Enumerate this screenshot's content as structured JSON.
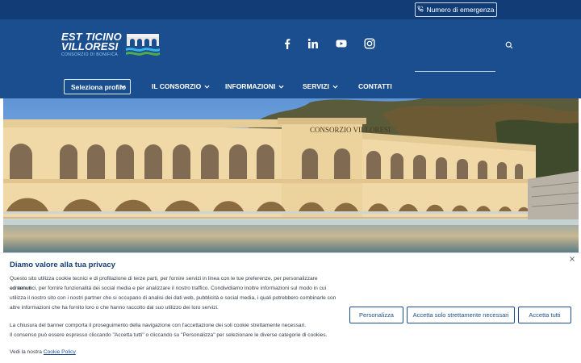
{
  "topbar": {
    "emergency_label": "Numero di emergenza"
  },
  "logo": {
    "line1": "EST TICINO",
    "line2": "VILLORESI",
    "subtitle": "CONSORZIO DI BONIFICA"
  },
  "social": [
    "facebook-icon",
    "linkedin-icon",
    "youtube-icon",
    "instagram-icon"
  ],
  "search": {
    "placeholder": ""
  },
  "nav": {
    "profile_label": "Seleziona profilo",
    "items": [
      {
        "label": "IL CONSORZIO",
        "has_dropdown": true
      },
      {
        "label": "INFORMAZIONI",
        "has_dropdown": true
      },
      {
        "label": "SERVIZI",
        "has_dropdown": true
      },
      {
        "label": "CONTATTI",
        "has_dropdown": false
      }
    ]
  },
  "hero": {
    "building_sign": "CONSORZIO VILLORESI"
  },
  "cookie": {
    "title": "Diamo valore alla tua privacy",
    "p1_l1": "Questo sito utilizza cookie tecnici e di profilazione di terze parti, per fornire servizi in linea con le tue preferenze, per personalizzare contenuti",
    "p1_l2": "ed annunci, per fornire funzionalità dei social media e per analizzare il nostro traffico. Condividiamo inoltre informazioni sul modo in cui",
    "p1_l3": "utilizza il nostro sito con i nostri partner che si occupano di analisi dei dati web, pubblicità e social media, i quali potrebbero combinarle con",
    "p1_l4": "altre informazioni che ha fornito loro o che hanno raccolto dal suo utilizzo dei loro servizi.",
    "p2_l1": "La chiusura del banner comporta il proseguimento della navigazione con l'accettazione dei soli cookie strettamente necessari.",
    "p2_l2": "Il consenso può essere espresso cliccando \"Accetta tutti\" o cliccando su \"Personalizza\" per selezionare le diverse categorie di cookies.",
    "policy_prefix": "Vedi la nostra",
    "policy_link": "Cookie Policy",
    "btn_customize": "Personalizza",
    "btn_necessary": "Accetta solo strettamente necessari",
    "btn_accept_all": "Accetta tutti"
  },
  "colors": {
    "topbar": "#123c76",
    "header": "#1b4e8e",
    "accent": "#1b4e8e"
  }
}
